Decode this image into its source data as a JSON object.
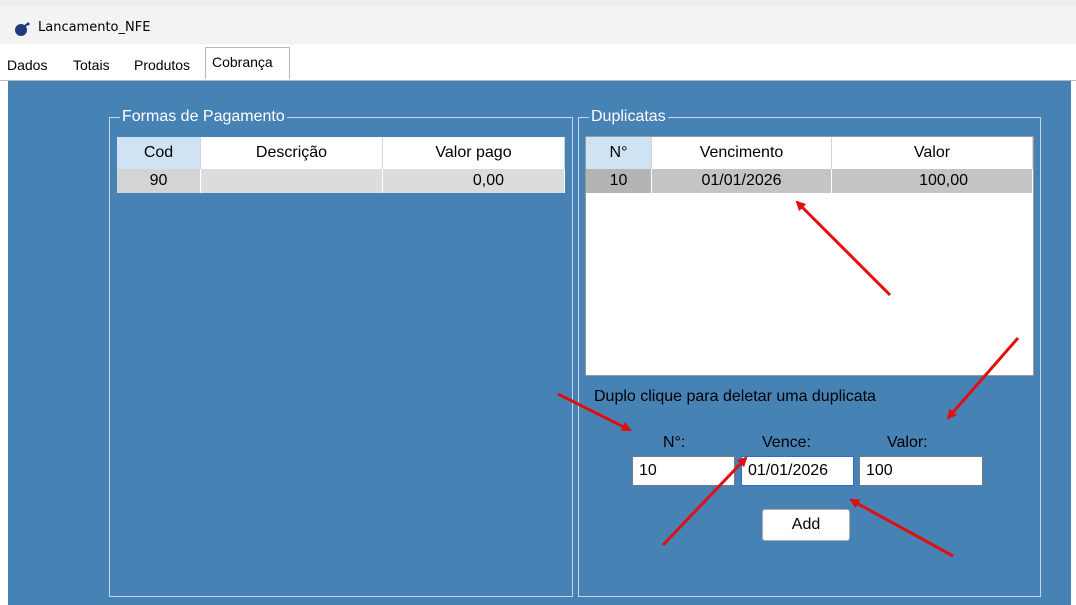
{
  "window": {
    "title": "Lancamento_NFE"
  },
  "tabs": [
    {
      "label": "Dados"
    },
    {
      "label": "Totais"
    },
    {
      "label": "Produtos"
    },
    {
      "label": "Cobrança",
      "active": true
    }
  ],
  "formas": {
    "title": "Formas de Pagamento",
    "columns": [
      "Cod",
      "Descrição",
      "Valor pago"
    ],
    "rows": [
      {
        "cod": "90",
        "descricao": "",
        "valor": "0,00"
      }
    ]
  },
  "duplicatas": {
    "title": "Duplicatas",
    "columns": [
      "N°",
      "Vencimento",
      "Valor"
    ],
    "rows": [
      {
        "n": "10",
        "vencimento": "01/01/2026",
        "valor": "100,00"
      }
    ],
    "hint": "Duplo clique para deletar uma duplicata",
    "form": {
      "n_label": "N°:",
      "vence_label": "Vence:",
      "valor_label": "Valor:",
      "n_value": "10",
      "vence_value": "01/01/2026",
      "valor_value": "100",
      "add_label": "Add"
    }
  },
  "colors": {
    "panel": "#4682b4",
    "arrow": "#e01010",
    "selected_row": "#c0c0c0"
  }
}
